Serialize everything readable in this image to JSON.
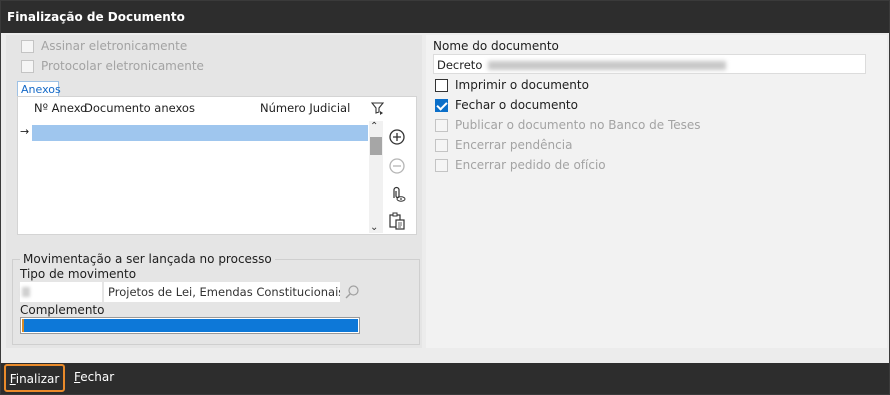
{
  "window": {
    "title": "Finalização de Documento"
  },
  "left": {
    "assinar_label": "Assinar eletronicamente",
    "protocolar_label": "Protocolar eletronicamente",
    "tab_label": "Anexos",
    "grid": {
      "col_num": "Nº Anexo",
      "col_doc": "Documento anexos",
      "col_judicial": "Número Judicial",
      "row_indicator": "→"
    },
    "movimentacao": {
      "legend": "Movimentação a ser lançada no processo",
      "tipo_label": "Tipo de movimento",
      "tipo_desc": "Projetos de Lei, Emendas Constitucionais e De",
      "complemento_label": "Complemento"
    }
  },
  "right": {
    "nome_label": "Nome do documento",
    "nome_value": "Decreto",
    "options": [
      {
        "label": "Imprimir o documento",
        "checked": false,
        "enabled": true
      },
      {
        "label": "Fechar o documento",
        "checked": true,
        "enabled": true
      },
      {
        "label": "Publicar o documento no Banco de Teses",
        "checked": false,
        "enabled": false
      },
      {
        "label": "Encerrar pendência",
        "checked": false,
        "enabled": false
      },
      {
        "label": "Encerrar pedido de ofício",
        "checked": false,
        "enabled": false
      }
    ]
  },
  "footer": {
    "finalizar_first": "F",
    "finalizar_rest": "inalizar",
    "fechar_first": "F",
    "fechar_rest": "echar"
  },
  "colors": {
    "titlebar": "#2d2d2d",
    "selected_row": "#9fc6ee",
    "accent_blue": "#0b6fc9",
    "focus_orange": "#e98a2a"
  }
}
